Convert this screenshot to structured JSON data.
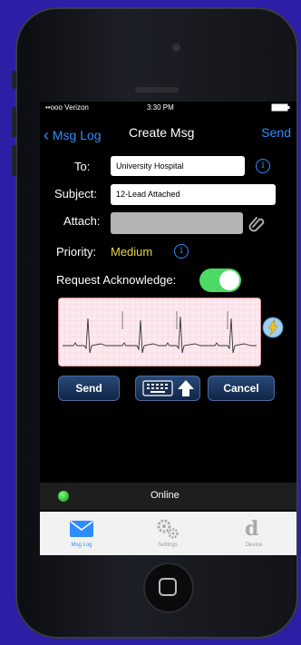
{
  "status_bar": {
    "carrier": "••ooo Verizon",
    "time": "3:30 PM",
    "battery": "100%"
  },
  "nav": {
    "back_label": "Msg Log",
    "title": "Create Msg",
    "send_label": "Send"
  },
  "form": {
    "to_label": "To:",
    "to_value": "University Hospital",
    "subject_label": "Subject:",
    "subject_value": "12-Lead Attached",
    "attach_label": "Attach:",
    "priority_label": "Priority:",
    "priority_value": "Medium",
    "request_ack_label": "Request Acknowledge:",
    "request_ack_on": true
  },
  "buttons": {
    "send": "Send",
    "cancel": "Cancel"
  },
  "connection": {
    "status": "Online"
  },
  "tabs": [
    {
      "label": "Msg Log",
      "icon": "envelope-icon",
      "active": true
    },
    {
      "label": "Settings",
      "icon": "gear-icon",
      "active": false
    },
    {
      "label": "Device",
      "icon": "device-icon",
      "active": false
    }
  ],
  "colors": {
    "background": "#2c1fa5",
    "accent": "#2f8cff",
    "priority": "#e8d64a",
    "toggle_on": "#4cd964"
  }
}
